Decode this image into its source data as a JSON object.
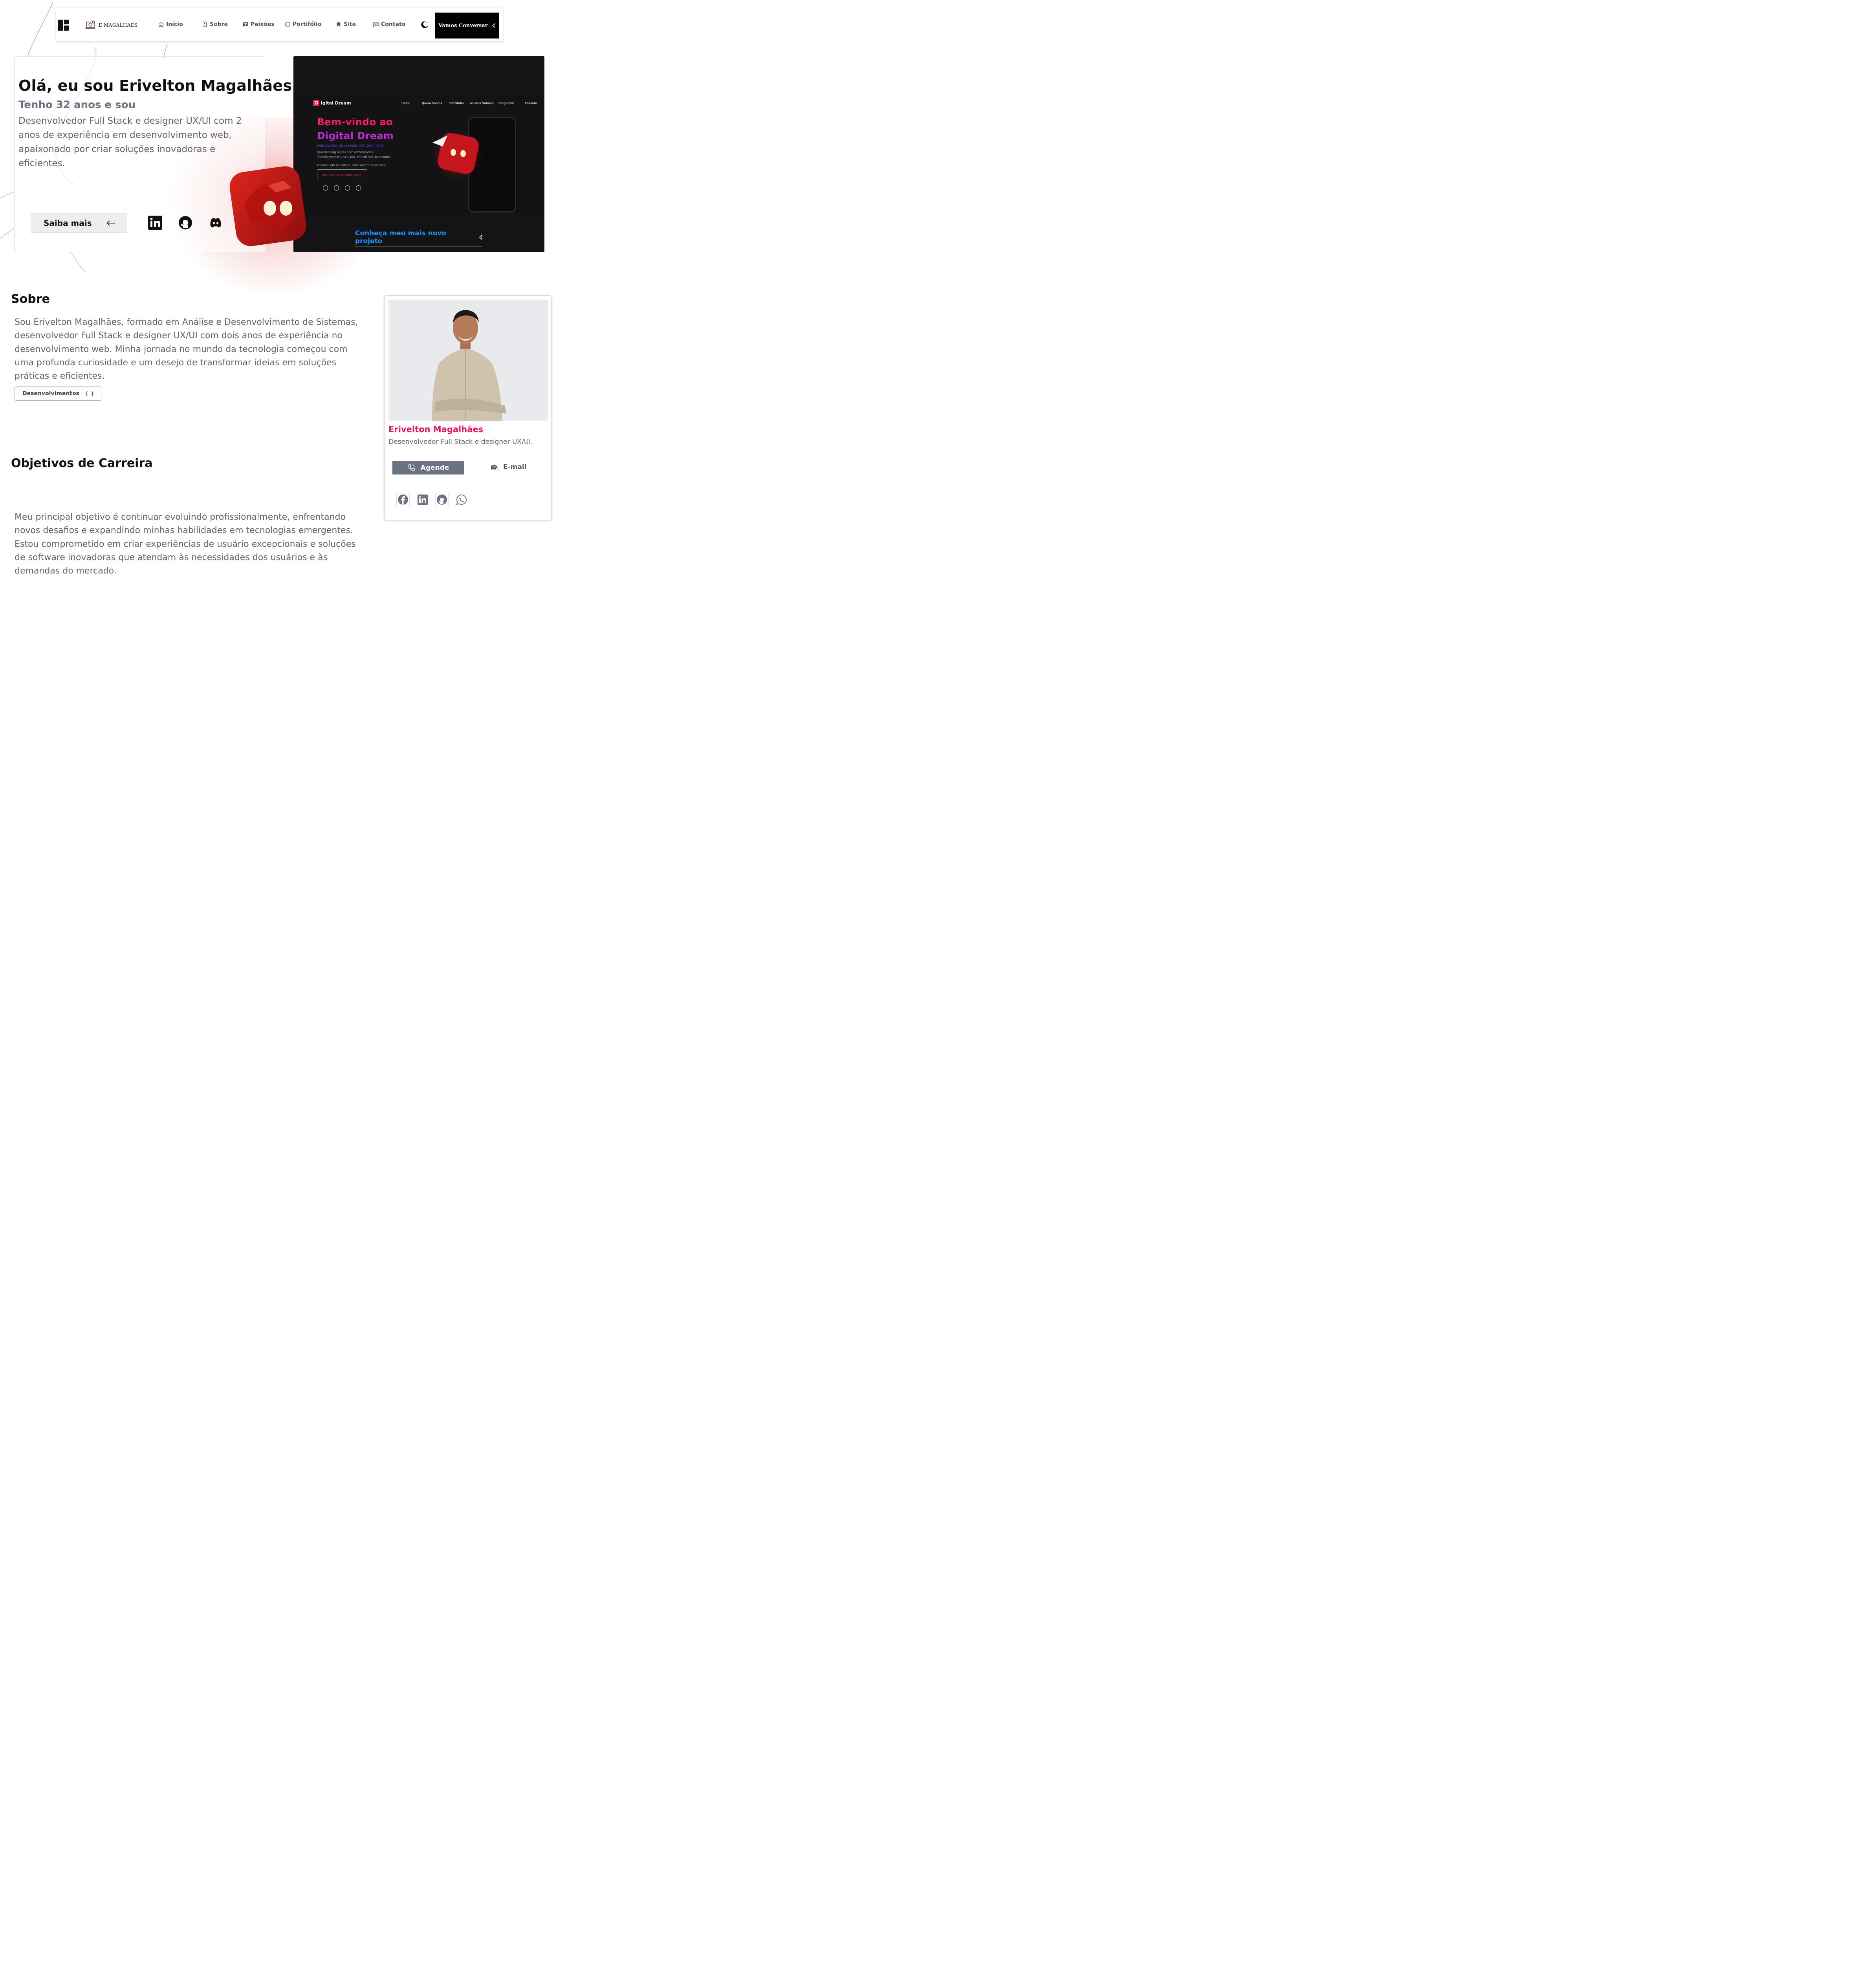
{
  "navbar": {
    "brand": "E MAGALHAES",
    "items": [
      {
        "label": "Início",
        "icon": "home-icon"
      },
      {
        "label": "Sobre",
        "icon": "profile-icon"
      },
      {
        "label": "Paixões",
        "icon": "chat-heart-icon"
      },
      {
        "label": "Portifólio",
        "icon": "files-icon"
      },
      {
        "label": "Site",
        "icon": "bookmarks-icon"
      },
      {
        "label": "Contato",
        "icon": "message-icon"
      }
    ],
    "cta": "Vamos Conversar"
  },
  "hero": {
    "title": "Olá, eu sou Erivelton Magalhães",
    "subtitle": "Tenho 32 anos e sou",
    "description": "Desenvolvedor Full Stack e designer UX/UI com 2 anos de experiência em desenvolvimento web, apaixonado por criar soluções inovadoras e eficientes.",
    "button": "Saiba mais",
    "socials": [
      "linkedin-icon",
      "github-icon",
      "discord-icon",
      "whatsapp-icon"
    ]
  },
  "project": {
    "logo_letter": "D",
    "logo_text": "igital Dream",
    "nav": [
      "Home",
      "Quem Somos",
      "Portifólio",
      "Nossos Valores",
      "Perguntas",
      "Contato"
    ],
    "headline_1": "Bem-vindo ao",
    "headline_2": "Digital Dream",
    "tagline": "PRECISANDO DE UM WEB DESIGNER PARA",
    "line_1": "Criar landing pages bem estruturadas?",
    "line_2": "Transformamos o seu site, em um imã de clientes!",
    "line_3": "Focando em qualidade, crescimento e vendas!",
    "cta_small": "Faça seu Orçamento gratis!",
    "cta": "Conheça meu mais novo projeto"
  },
  "sobre": {
    "title": "Sobre",
    "text": "Sou Erivelton Magalhães, formado em Análise e Desenvolvimento de Sistemas, desenvolvedor Full Stack e designer UX/UI com dois anos de experiência no desenvolvimento web. Minha jornada no mundo da tecnologia começou com uma profunda curiosidade e um desejo de transformar ideias em soluções práticas e eficientes.",
    "tag": "Desenvolvimentos",
    "tag_icon": "{ }"
  },
  "objetivos": {
    "title": "Objetivos de Carreira",
    "text": "Meu principal objetivo é continuar evoluindo profissionalmente, enfrentando novos desafios e expandindo minhas habilidades em tecnologias emergentes. Estou comprometido em criar experiências de usuário excepcionais e soluções de software inovadoras que atendam às necessidades dos usuários e às demandas do mercado."
  },
  "profile": {
    "name": "Erivelton Magalhães",
    "role": "Desenvolvedor Full Stack e designer UX/UI.",
    "agende": "Agende",
    "email": "E-mail",
    "socials": [
      "facebook-icon",
      "linkedin-icon",
      "github-icon",
      "whatsapp-icon"
    ]
  },
  "colors": {
    "accent_pink": "#e8175d",
    "project_blue": "#1e90ff",
    "button_gray": "#6b7280"
  }
}
